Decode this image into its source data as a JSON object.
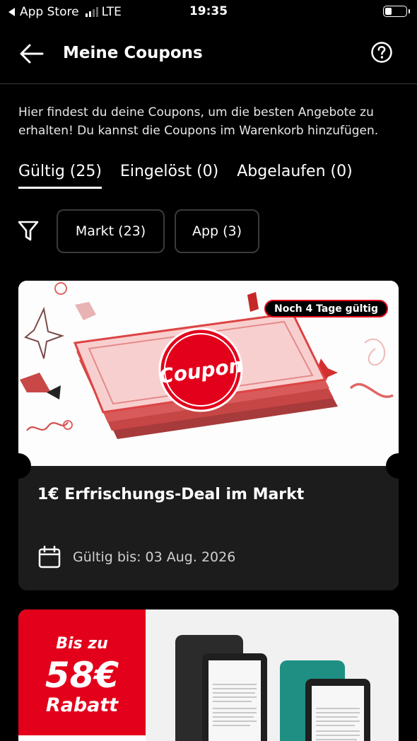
{
  "status_bar": {
    "carrier_back": "App Store",
    "network": "LTE",
    "time": "19:35"
  },
  "header": {
    "title": "Meine Coupons",
    "back_icon": "arrow-left-icon",
    "help_icon": "question-circle-icon"
  },
  "intro_text": "Hier findest du deine Coupons, um die besten Angebote zu erhalten! Du kannst die Coupons im Warenkorb hinzufügen.",
  "tabs": [
    {
      "label": "Gültig (25)",
      "active": true
    },
    {
      "label": "Eingelöst (0)",
      "active": false
    },
    {
      "label": "Abgelaufen (0)",
      "active": false
    }
  ],
  "filters": {
    "icon": "filter-funnel-icon",
    "chips": [
      {
        "label": "Markt (23)"
      },
      {
        "label": "App (3)"
      }
    ]
  },
  "coupon_card": {
    "badge": "Noch 4 Tage gültig",
    "image_text": "Coupon",
    "title": "1€ Erfrischungs-Deal im Markt",
    "calendar_icon": "calendar-icon",
    "valid_until": "Gültig bis: 03 Aug. 2026"
  },
  "promo_card": {
    "line1": "Bis zu",
    "line2": "58€",
    "line3": "Rabatt"
  },
  "colors": {
    "background": "#000000",
    "brand_red": "#e3001b",
    "card_bg": "#1c1c1c"
  }
}
